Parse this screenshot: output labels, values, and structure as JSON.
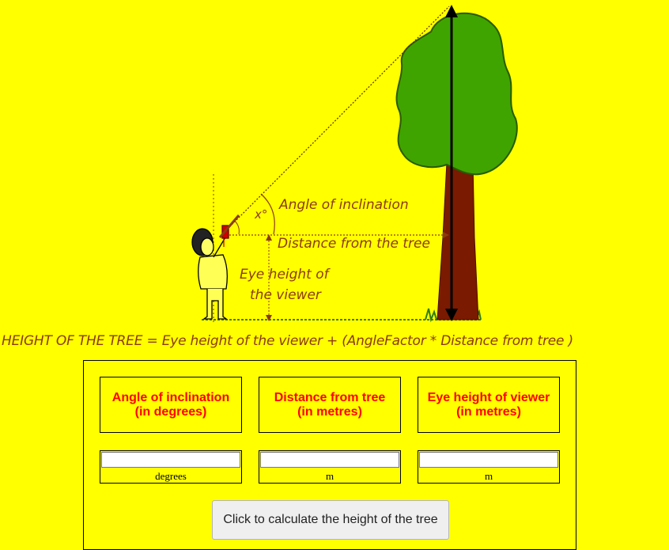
{
  "diagram": {
    "angle_label": "Angle of inclination",
    "angle_symbol": "x°",
    "distance_label": "Distance from the tree",
    "eye_height_label_line1": "Eye height of",
    "eye_height_label_line2": "the viewer"
  },
  "formula": "HEIGHT OF THE TREE =  Eye height of the viewer + (AngleFactor * Distance from tree )",
  "headers": {
    "angle_line1": "Angle of inclination",
    "angle_line2": "(in degrees)",
    "distance_line1": "Distance from tree",
    "distance_line2": "(in metres)",
    "eye_line1": "Eye height of viewer",
    "eye_line2": "(in metres)"
  },
  "inputs": {
    "angle_value": "",
    "angle_unit": "degrees",
    "distance_value": "",
    "distance_unit": "m",
    "eye_value": "",
    "eye_unit": "m"
  },
  "button_label": "Click to calculate the height of the tree",
  "colors": {
    "background": "#ffff00",
    "label_brown": "#8b3a0e",
    "header_red": "#ff0000",
    "foliage_green": "#3fa400",
    "trunk_brown": "#7a1a00"
  }
}
